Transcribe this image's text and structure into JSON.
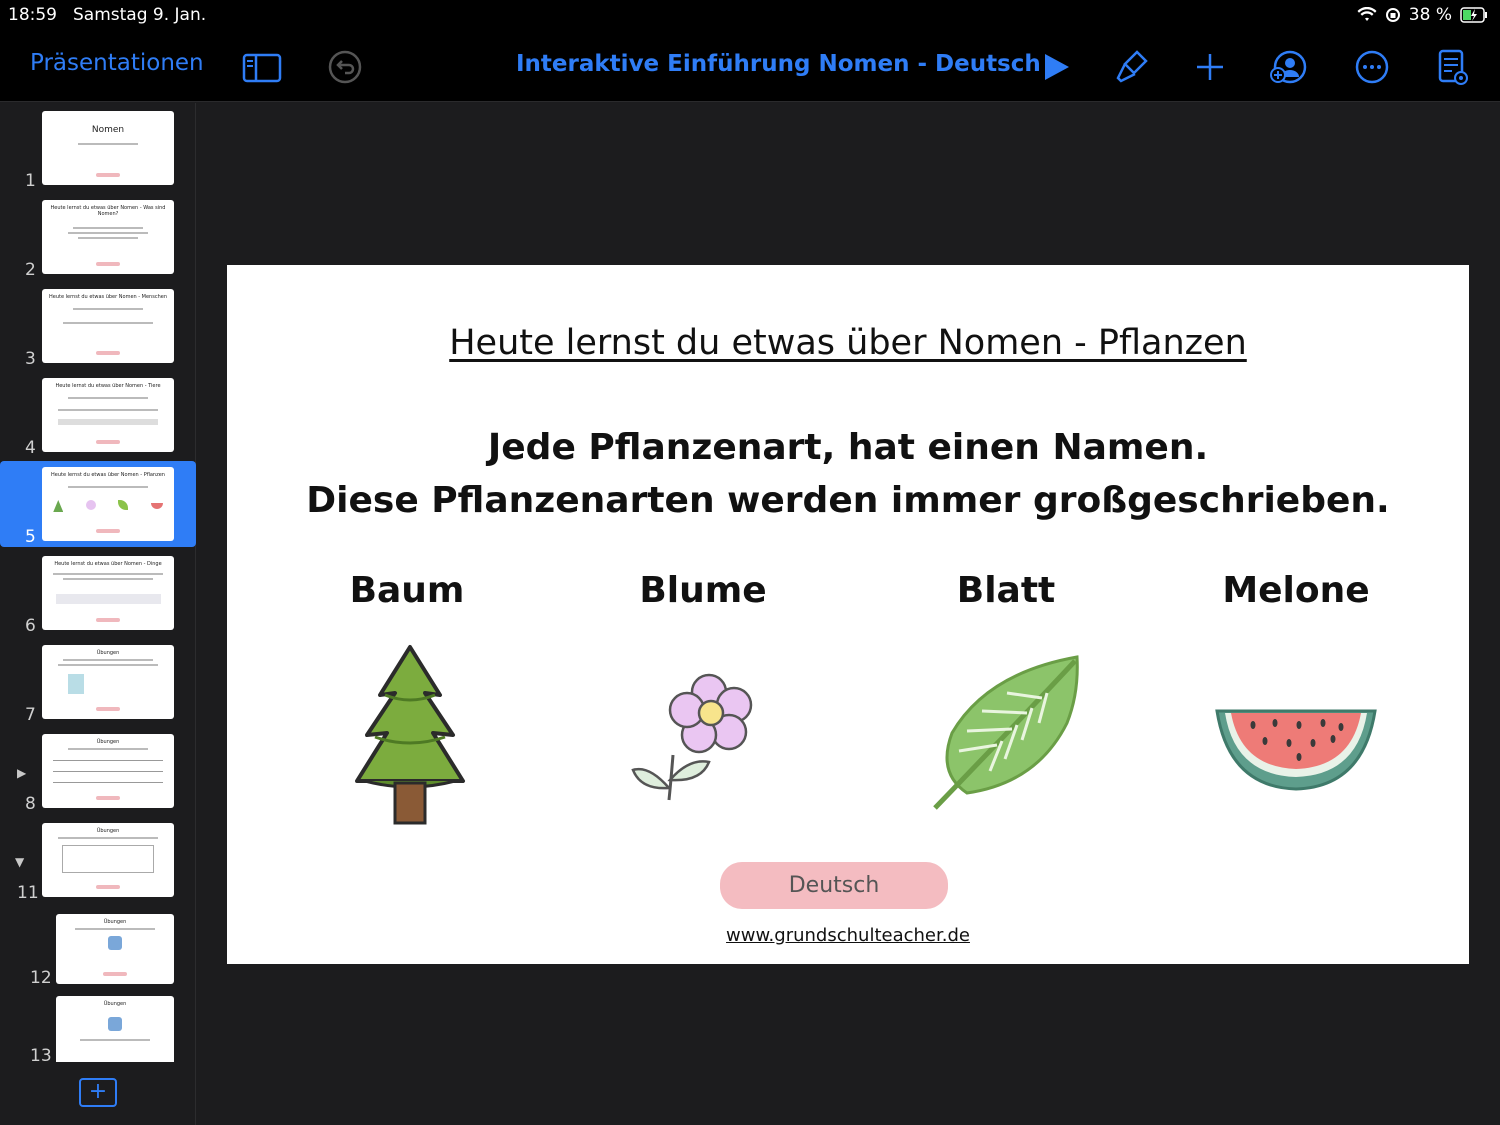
{
  "status": {
    "time": "18:59",
    "date": "Samstag 9. Jan.",
    "battery": "38 %"
  },
  "toolbar": {
    "back_label": "Präsentationen",
    "document_title": "Interaktive Einführung Nomen - Deutsch",
    "icons": [
      "sidebar-icon",
      "undo-icon",
      "play-icon",
      "format-brush-icon",
      "plus-icon",
      "collaborate-icon",
      "more-icon",
      "presenter-notes-icon"
    ]
  },
  "sidebar": {
    "thumbnails": [
      {
        "number": "1",
        "title": "Nomen"
      },
      {
        "number": "2",
        "title": "Heute lernst du etwas über Nomen - Was sind Nomen?"
      },
      {
        "number": "3",
        "title": "Heute lernst du etwas über Nomen - Menschen"
      },
      {
        "number": "4",
        "title": "Heute lernst du etwas über Nomen - Tiere"
      },
      {
        "number": "5",
        "title": "Heute lernst du etwas über Nomen - Pflanzen",
        "selected": true
      },
      {
        "number": "6",
        "title": "Heute lernst du etwas über Nomen - Dinge"
      },
      {
        "number": "7",
        "title": "Übungen"
      },
      {
        "number": "8",
        "title": "Übungen"
      },
      {
        "number": "11",
        "title": "Übungen"
      },
      {
        "number": "12",
        "title": "Übungen"
      },
      {
        "number": "13",
        "title": "Übungen"
      }
    ]
  },
  "slide": {
    "heading": "Heute lernst du etwas über Nomen - Pflanzen",
    "line1": "Jede Pflanzenart, hat einen Namen.",
    "line2": "Diese Pflanzenarten werden immer großgeschrieben.",
    "words": [
      "Baum",
      "Blume",
      "Blatt",
      "Melone"
    ],
    "subject_tag": "Deutsch",
    "url": "www.grundschulteacher.de"
  },
  "colors": {
    "accent": "#2f7df6",
    "tag_pink": "#f4bcc1"
  }
}
